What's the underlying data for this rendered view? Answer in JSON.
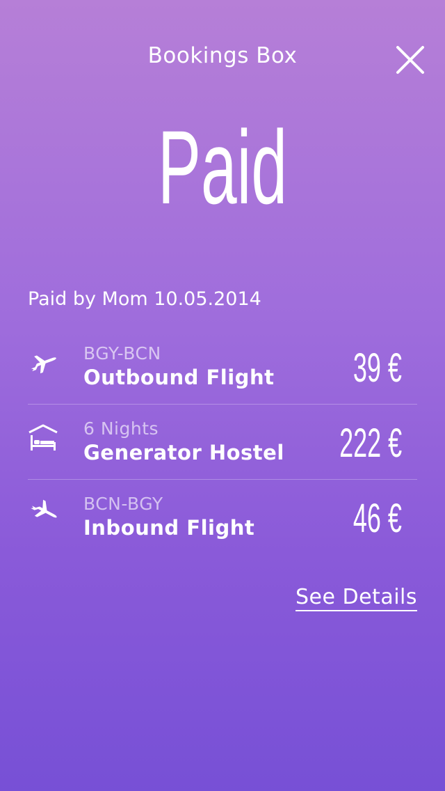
{
  "header": {
    "title": "Bookings Box",
    "close_icon": "close-icon"
  },
  "status": {
    "label": "Paid"
  },
  "payment": {
    "paid_by": "Paid by Mom 10.05.2014"
  },
  "items": [
    {
      "icon": "airplane-takeoff-icon",
      "code": "BGY-BCN",
      "name": "Outbound Flight",
      "price": "39 €"
    },
    {
      "icon": "hostel-bed-icon",
      "code": "6 Nights",
      "name": "Generator Hostel",
      "price": "222 €"
    },
    {
      "icon": "airplane-landing-icon",
      "code": "BCN-BGY",
      "name": "Inbound Flight",
      "price": "46 €"
    }
  ],
  "actions": {
    "see_details": "See Details"
  },
  "colors": {
    "gradient_top": "#b67fd7",
    "gradient_bottom": "#7750d6",
    "text": "#ffffff"
  }
}
